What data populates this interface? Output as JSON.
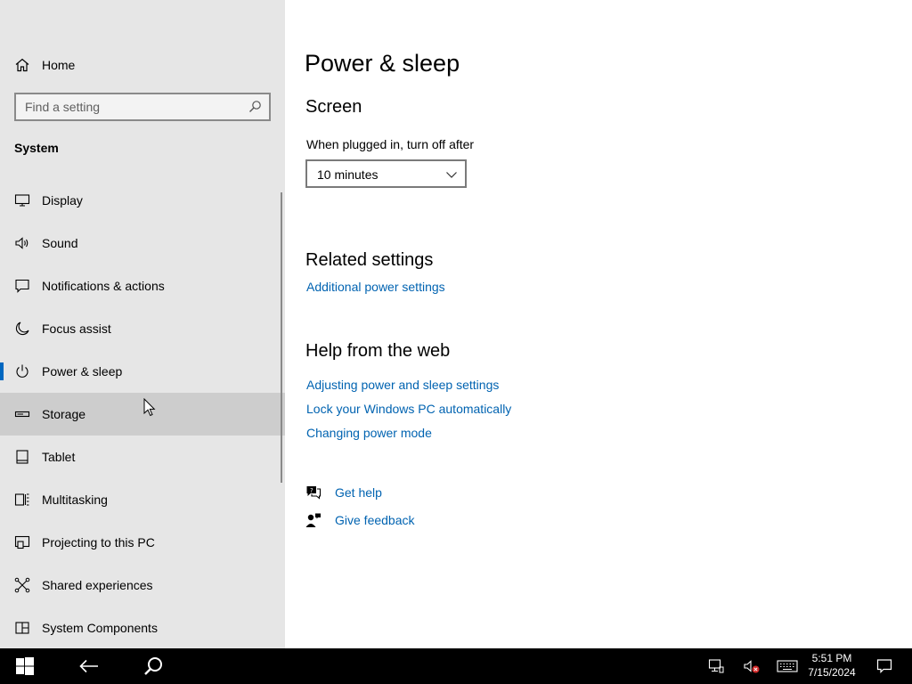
{
  "sidebar": {
    "home_label": "Home",
    "search_placeholder": "Find a setting",
    "section_title": "System",
    "items": [
      {
        "label": "Display",
        "icon": "monitor-icon"
      },
      {
        "label": "Sound",
        "icon": "speaker-icon"
      },
      {
        "label": "Notifications & actions",
        "icon": "message-icon"
      },
      {
        "label": "Focus assist",
        "icon": "moon-icon"
      },
      {
        "label": "Power & sleep",
        "icon": "power-icon",
        "selected": true
      },
      {
        "label": "Storage",
        "icon": "storage-drive-icon",
        "hovered": true
      },
      {
        "label": "Tablet",
        "icon": "tablet-icon"
      },
      {
        "label": "Multitasking",
        "icon": "multitasking-icon"
      },
      {
        "label": "Projecting to this PC",
        "icon": "projecting-icon"
      },
      {
        "label": "Shared experiences",
        "icon": "shared-experiences-icon"
      },
      {
        "label": "System Components",
        "icon": "components-icon"
      }
    ]
  },
  "main": {
    "title": "Power & sleep",
    "screen": {
      "heading": "Screen",
      "plugged_label": "When plugged in, turn off after",
      "plugged_value": "10 minutes"
    },
    "related": {
      "heading": "Related settings",
      "links": [
        "Additional power settings"
      ]
    },
    "help_web": {
      "heading": "Help from the web",
      "links": [
        "Adjusting power and sleep settings",
        "Lock your Windows PC automatically",
        "Changing power mode"
      ]
    },
    "get_help": "Get help",
    "give_feedback": "Give feedback"
  },
  "taskbar": {
    "time": "5:51 PM",
    "date": "7/15/2024"
  },
  "colors": {
    "accent": "#0067c0",
    "link": "#0063b1",
    "sidebar_bg": "#e6e6e6",
    "hover_bg": "#cdcdcd",
    "taskbar_bg": "#000000"
  }
}
